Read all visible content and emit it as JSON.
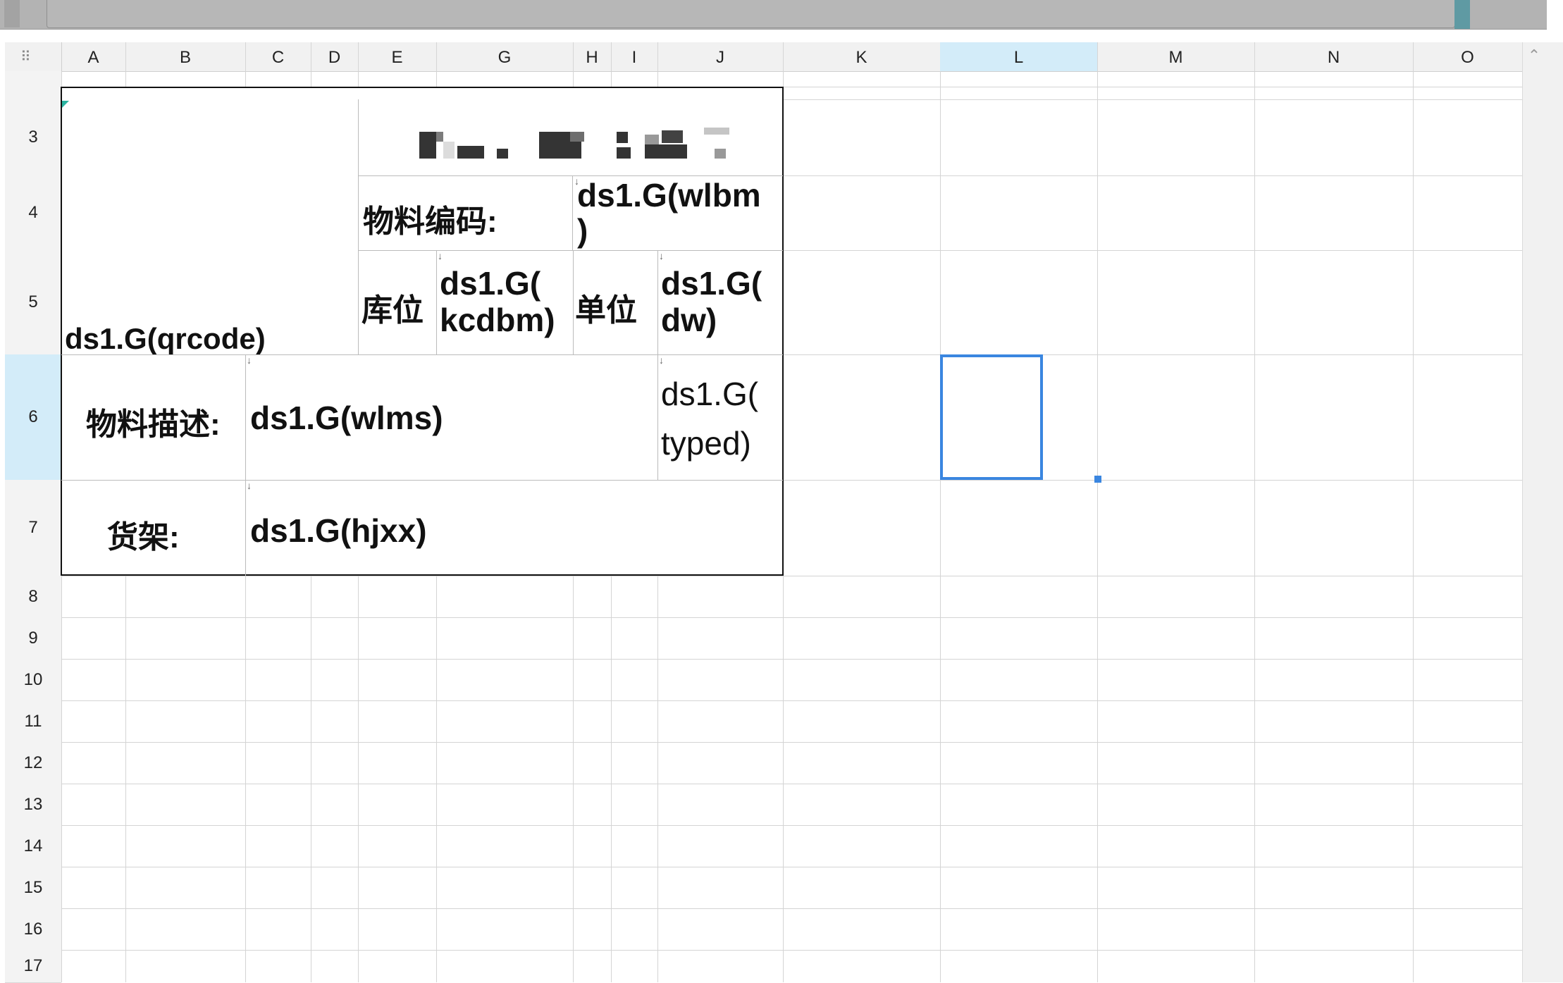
{
  "columns": [
    {
      "label": "A"
    },
    {
      "label": "B"
    },
    {
      "label": "C"
    },
    {
      "label": "D"
    },
    {
      "label": "E"
    },
    {
      "label": "G"
    },
    {
      "label": "H"
    },
    {
      "label": "I"
    },
    {
      "label": "J"
    },
    {
      "label": "K"
    },
    {
      "label": "L"
    },
    {
      "label": "M"
    },
    {
      "label": "N"
    },
    {
      "label": "O"
    }
  ],
  "rows": [
    "3",
    "4",
    "5",
    "6",
    "7",
    "8",
    "9",
    "10",
    "11",
    "12",
    "13",
    "14",
    "15",
    "16",
    "17"
  ],
  "active_column": "L",
  "active_row": "6",
  "report": {
    "qrcode": "ds1.G(qrcode)",
    "material_code_label": "物料编码:",
    "material_code_value": "ds1.G(wlbm\n)",
    "location_label": "库位",
    "location_value": "ds1.G(\nkcdbm)",
    "unit_label": "单位",
    "unit_value": "ds1.G(\ndw)",
    "description_label": "物料描述:",
    "description_value": "ds1.G(wlms)",
    "type_value": "ds1.G(\ntyped)",
    "shelf_label": "货架:",
    "shelf_value": "ds1.G(hjxx)"
  },
  "icons": {
    "menu_grid": "grid-dots-icon",
    "scroll_up": "chevron-up-icon",
    "cell_arrow": "down-arrow-icon"
  },
  "colors": {
    "selection": "#3a86e0",
    "active_header": "#d3ecf9",
    "formula_bar": "#b3b3b3",
    "handle": "#5f9aa3"
  }
}
